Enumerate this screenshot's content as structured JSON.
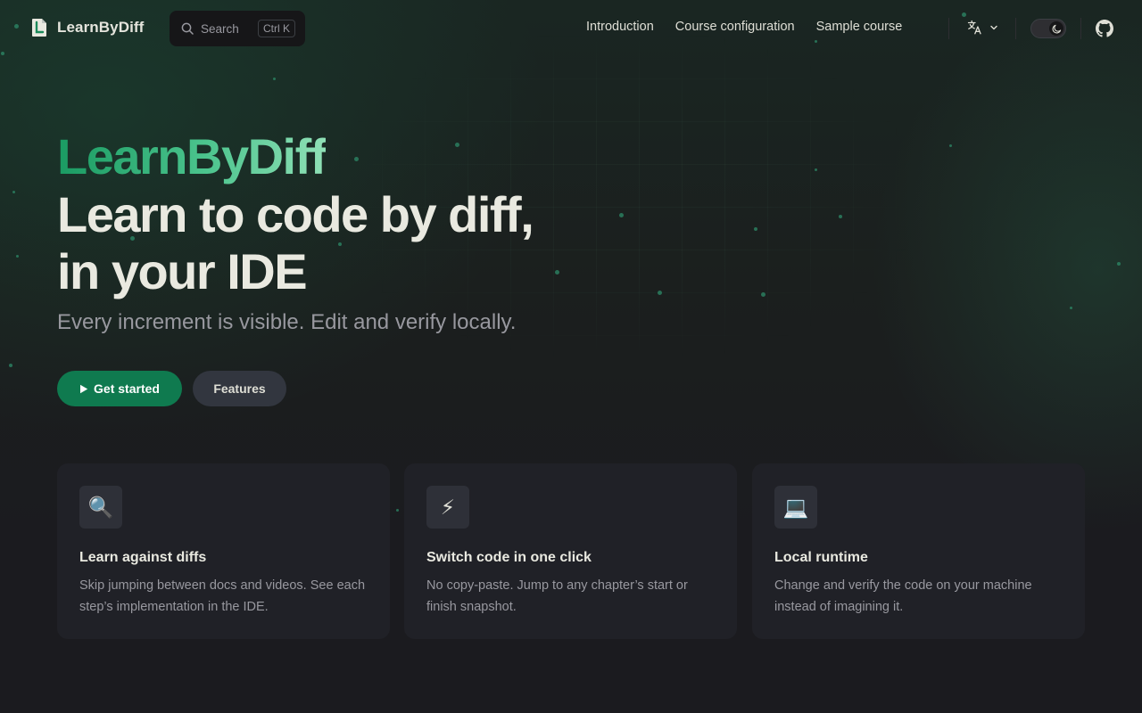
{
  "nav": {
    "brand": "LearnByDiff",
    "search_label": "Search",
    "search_kbd": "Ctrl K",
    "links": [
      {
        "label": "Introduction"
      },
      {
        "label": "Course configuration"
      },
      {
        "label": "Sample course"
      }
    ],
    "icons": {
      "search": "search-icon",
      "language": "translate-icon",
      "language_caret": "chevron-down-icon",
      "theme": "moon-icon",
      "github": "github-icon"
    }
  },
  "hero": {
    "name": "LearnByDiff",
    "text_line1": "Learn to code by diff,",
    "text_line2": "in your IDE",
    "tagline": "Every increment is visible. Edit and verify locally.",
    "primary_action": "Get started",
    "secondary_action": "Features"
  },
  "features": [
    {
      "icon": "🔍",
      "title": "Learn against diffs",
      "details": "Skip jumping between docs and videos. See each step’s implementation in the IDE."
    },
    {
      "icon": "⚡",
      "title": "Switch code in one click",
      "details": "No copy-paste. Jump to any chapter’s start or finish snapshot."
    },
    {
      "icon": "💻",
      "title": "Local runtime",
      "details": "Change and verify the code on your machine instead of imagining it."
    }
  ],
  "colors": {
    "brand": "#0f7a4f",
    "brand_gradient_start": "#1a9a62",
    "brand_gradient_end": "#8fe0b6",
    "background": "#1b1b1f",
    "card": "#202127"
  }
}
